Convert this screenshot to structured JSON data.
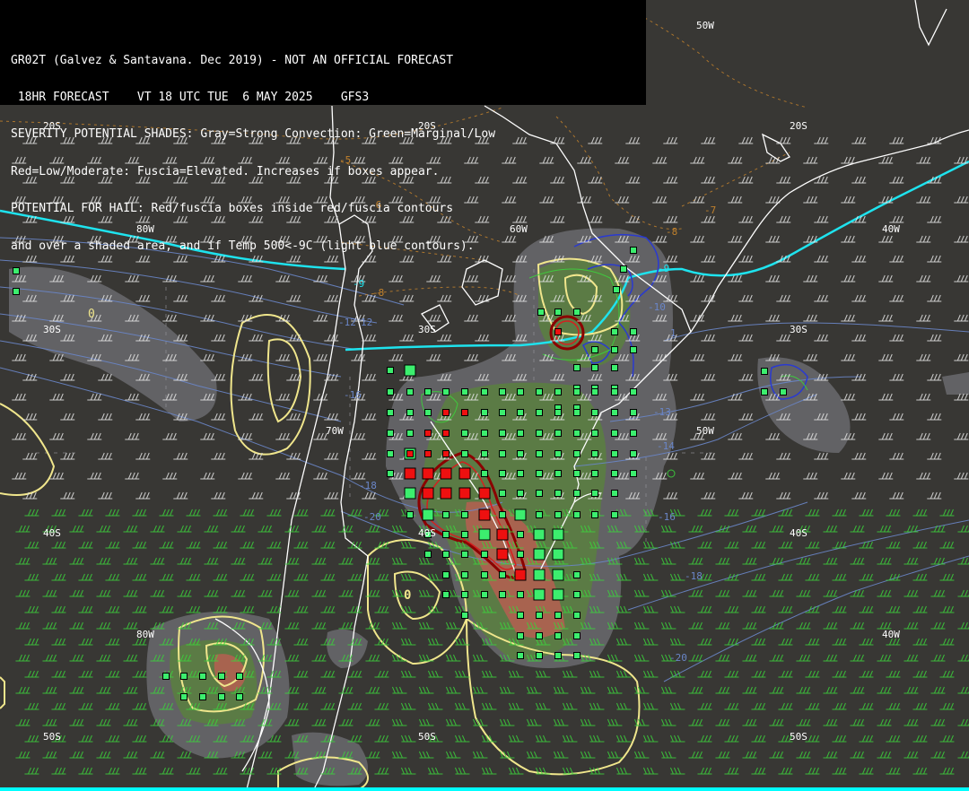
{
  "header": {
    "line1": "GR02T (Galvez & Santavana. Dec 2019) - NOT AN OFFICIAL FORECAST",
    "line2": " 18HR FORECAST    VT 18 UTC TUE  6 MAY 2025    GFS3",
    "line3": "SEVERITY POTENTIAL SHADES: Gray=Strong Convection: Green=Marginal/Low",
    "line4": "Red=Low/Moderate: Fuscia=Elevated. Increases if boxes appear.",
    "line5": "POTENTIAL FOR HAIL: Red/fuscia boxes inside red/fuscia contours",
    "line6": "and over a shaded area, and if Temp 500<-9C (light blue contours)."
  },
  "grid_labels": {
    "lon_80w_top": "80W",
    "lon_60w": "60W",
    "lon_40w_top": "40W",
    "lon_50w_top": "50W",
    "lon_70w": "70W",
    "lon_50w_mid": "50W",
    "lon_80w_bottom": "80W",
    "lon_40w_bottom": "40W",
    "lat_20s_left": "20S",
    "lat_20s_mid": "20S",
    "lat_20s_right": "20S",
    "lat_30s_left": "30S",
    "lat_30s_mid": "30S",
    "lat_30s_right": "30S",
    "lat_40s_left": "40S",
    "lat_40s_mid": "40S",
    "lat_40s_right": "40S",
    "lat_50s_left": "50S",
    "lat_50s_mid": "50S",
    "lat_50s_right": "50S"
  },
  "contour_labels": {
    "t5": "-5",
    "t6": "-6",
    "t7": "-7",
    "t8": "-8",
    "t8b": "-8",
    "t9a": "-9",
    "t9b": "-9",
    "t10": "-10",
    "t12a": "-12",
    "t12b": "12",
    "t13": "-13",
    "t14": "-14",
    "t16a": "-16",
    "t16b": "-16",
    "t18a": "-18",
    "t18b": "-18",
    "t20a": "-20",
    "t20b": "-20",
    "t1": "1",
    "t0a": "0",
    "t0b": "0"
  },
  "colors": {
    "background": "#383734",
    "gray_shade": "#6a6a6e",
    "green_shade": "#5a8040",
    "red_shade": "#b06050",
    "box_green": "#3cee6e",
    "box_red": "#ee1010",
    "coast": "#ffffff",
    "yellow_contour": "#f0e68c",
    "cyan_line": "#1ee3ee",
    "temp_contour": "#6a86c8",
    "hail_contour": "#8b0000",
    "brown_contour": "#c0802c",
    "wind_barb": "#e6e6e6",
    "wind_barb_south": "#3cd23c"
  }
}
